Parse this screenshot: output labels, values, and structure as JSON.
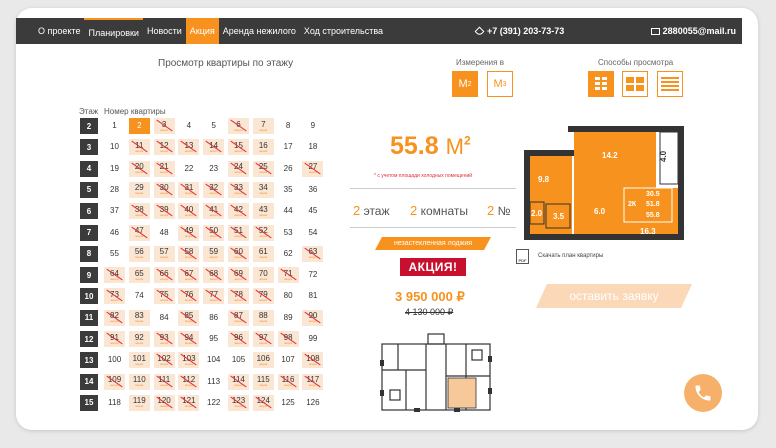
{
  "nav": {
    "items": [
      {
        "label": "О проекте",
        "highlight": false
      },
      {
        "label": "Планировки",
        "highlight": false
      },
      {
        "label": "Новости",
        "highlight": false
      },
      {
        "label": "Акция",
        "highlight": true
      },
      {
        "label": "Аренда нежилого",
        "highlight": false
      },
      {
        "label": "Ход строительства",
        "highlight": false
      }
    ],
    "phone": "+7 (391) 203-73-73",
    "email": "2880055@mail.ru"
  },
  "heading": "Просмотр квартиры по этажу",
  "units": {
    "label": "Измерения в",
    "m2": "М",
    "m3": "М",
    "m2_sup": "2",
    "m3_sup": "3"
  },
  "view_modes": {
    "label": "Способы просмотра"
  },
  "grid": {
    "floor_header": "Этаж",
    "apt_header": "Номер квартиры",
    "promo_tag": "акция",
    "floors": [
      {
        "floor": "2",
        "apts": [
          [
            "1",
            ""
          ],
          [
            "2",
            "sel"
          ],
          [
            "3",
            "sold"
          ],
          [
            "4",
            ""
          ],
          [
            "5",
            ""
          ],
          [
            "6",
            "sold"
          ],
          [
            "7",
            "promo"
          ],
          [
            "8",
            ""
          ],
          [
            "9",
            ""
          ]
        ]
      },
      {
        "floor": "3",
        "apts": [
          [
            "10",
            ""
          ],
          [
            "11",
            "sold"
          ],
          [
            "12",
            "sold"
          ],
          [
            "13",
            "sold"
          ],
          [
            "14",
            "sold"
          ],
          [
            "15",
            "sold"
          ],
          [
            "16",
            "promo"
          ],
          [
            "17",
            ""
          ],
          [
            "18",
            ""
          ]
        ]
      },
      {
        "floor": "4",
        "apts": [
          [
            "19",
            ""
          ],
          [
            "20",
            "sold"
          ],
          [
            "21",
            "sold"
          ],
          [
            "22",
            ""
          ],
          [
            "23",
            ""
          ],
          [
            "24",
            "sold"
          ],
          [
            "25",
            "sold"
          ],
          [
            "26",
            ""
          ],
          [
            "27",
            "sold"
          ]
        ]
      },
      {
        "floor": "5",
        "apts": [
          [
            "28",
            ""
          ],
          [
            "29",
            "promo"
          ],
          [
            "30",
            "sold"
          ],
          [
            "31",
            "sold"
          ],
          [
            "32",
            "sold"
          ],
          [
            "33",
            "sold"
          ],
          [
            "34",
            "promo"
          ],
          [
            "35",
            ""
          ],
          [
            "36",
            ""
          ]
        ]
      },
      {
        "floor": "6",
        "apts": [
          [
            "37",
            ""
          ],
          [
            "38",
            "sold"
          ],
          [
            "39",
            "sold"
          ],
          [
            "40",
            "sold"
          ],
          [
            "41",
            "sold"
          ],
          [
            "42",
            "sold"
          ],
          [
            "43",
            "promo"
          ],
          [
            "44",
            ""
          ],
          [
            "45",
            ""
          ]
        ]
      },
      {
        "floor": "7",
        "apts": [
          [
            "46",
            ""
          ],
          [
            "47",
            "sold"
          ],
          [
            "48",
            ""
          ],
          [
            "49",
            "sold"
          ],
          [
            "50",
            "sold"
          ],
          [
            "51",
            "sold"
          ],
          [
            "52",
            "sold"
          ],
          [
            "53",
            ""
          ],
          [
            "54",
            ""
          ]
        ]
      },
      {
        "floor": "8",
        "apts": [
          [
            "55",
            ""
          ],
          [
            "56",
            "promo"
          ],
          [
            "57",
            "promo"
          ],
          [
            "58",
            "sold"
          ],
          [
            "59",
            "promo"
          ],
          [
            "60",
            "sold"
          ],
          [
            "61",
            "promo"
          ],
          [
            "62",
            ""
          ],
          [
            "63",
            "sold"
          ]
        ]
      },
      {
        "floor": "9",
        "apts": [
          [
            "64",
            "sold"
          ],
          [
            "65",
            "promo"
          ],
          [
            "66",
            "sold"
          ],
          [
            "67",
            "sold"
          ],
          [
            "68",
            "sold"
          ],
          [
            "69",
            "sold"
          ],
          [
            "70",
            "promo"
          ],
          [
            "71",
            "sold"
          ],
          [
            "72",
            ""
          ]
        ]
      },
      {
        "floor": "10",
        "apts": [
          [
            "73",
            "sold"
          ],
          [
            "74",
            ""
          ],
          [
            "75",
            "sold"
          ],
          [
            "76",
            "sold"
          ],
          [
            "77",
            "sold"
          ],
          [
            "78",
            "sold"
          ],
          [
            "79",
            "sold"
          ],
          [
            "80",
            ""
          ],
          [
            "81",
            ""
          ]
        ]
      },
      {
        "floor": "11",
        "apts": [
          [
            "82",
            "sold"
          ],
          [
            "83",
            "promo"
          ],
          [
            "84",
            ""
          ],
          [
            "85",
            "sold"
          ],
          [
            "86",
            ""
          ],
          [
            "87",
            "sold"
          ],
          [
            "88",
            "promo"
          ],
          [
            "89",
            ""
          ],
          [
            "90",
            "sold"
          ]
        ]
      },
      {
        "floor": "12",
        "apts": [
          [
            "91",
            "sold"
          ],
          [
            "92",
            "promo"
          ],
          [
            "93",
            "sold"
          ],
          [
            "94",
            "sold"
          ],
          [
            "95",
            ""
          ],
          [
            "96",
            "sold"
          ],
          [
            "97",
            "sold"
          ],
          [
            "98",
            "sold"
          ],
          [
            "99",
            ""
          ]
        ]
      },
      {
        "floor": "13",
        "apts": [
          [
            "100",
            ""
          ],
          [
            "101",
            "promo"
          ],
          [
            "102",
            "sold"
          ],
          [
            "103",
            "sold"
          ],
          [
            "104",
            ""
          ],
          [
            "105",
            ""
          ],
          [
            "106",
            "promo"
          ],
          [
            "107",
            ""
          ],
          [
            "108",
            "sold"
          ]
        ]
      },
      {
        "floor": "14",
        "apts": [
          [
            "109",
            "sold"
          ],
          [
            "110",
            "promo"
          ],
          [
            "111",
            "sold"
          ],
          [
            "112",
            "sold"
          ],
          [
            "113",
            ""
          ],
          [
            "114",
            "sold"
          ],
          [
            "115",
            "promo"
          ],
          [
            "116",
            "sold"
          ],
          [
            "117",
            "sold"
          ]
        ]
      },
      {
        "floor": "15",
        "apts": [
          [
            "118",
            ""
          ],
          [
            "119",
            "promo"
          ],
          [
            "120",
            "sold"
          ],
          [
            "121",
            "sold"
          ],
          [
            "122",
            ""
          ],
          [
            "123",
            "sold"
          ],
          [
            "124",
            "sold"
          ],
          [
            "125",
            ""
          ],
          [
            "126",
            ""
          ]
        ]
      }
    ]
  },
  "apartment": {
    "area": "55.8",
    "area_unit": "М",
    "area_sup": "2",
    "note": "* с учетом площади холодных помещений",
    "floor_num": "2",
    "floor_word": "этаж",
    "rooms_num": "2",
    "rooms_word": "комнаты",
    "num_num": "2",
    "num_word": "№",
    "ribbon": "незастекленная лоджия",
    "promo": "АКЦИЯ!",
    "price": "3 950 000 ₽",
    "old_price": "4 130 000 ₽",
    "download_label": "Скачать план квартиры",
    "pdf_label": "PDF",
    "cta": "оставить заявку"
  },
  "plan": {
    "rooms": [
      "14.2",
      "4.0",
      "9.8",
      "2.0",
      "3.5",
      "6.0",
      "16.3"
    ],
    "summary": [
      "30.5",
      "2К",
      "51.8",
      "55.8"
    ]
  },
  "colors": {
    "accent": "#f7921e",
    "dark": "#3b3b3b",
    "sold_line": "#e0303a",
    "promo": "#c8102e"
  }
}
